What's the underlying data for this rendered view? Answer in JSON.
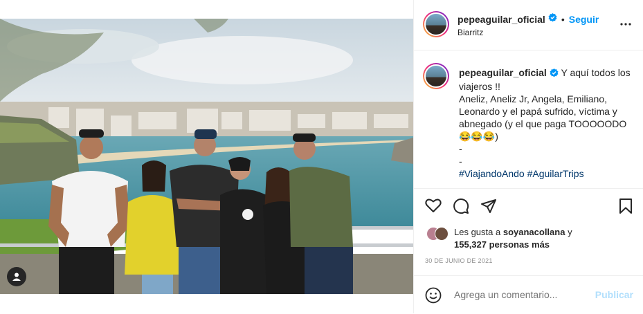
{
  "post": {
    "username": "pepeaguilar_oficial",
    "location": "Biarritz",
    "follow_label": "Seguir",
    "separator": "•"
  },
  "caption": {
    "username": "pepeaguilar_oficial",
    "lines": [
      "Y aquí todos los viajeros !!",
      "Aneliz, Aneliz Jr, Angela, Emiliano, Leonardo y el papá sufrido, víctima y abnegado (y el que paga TOOOOODO 😂😂😂)",
      "-",
      "-"
    ],
    "hashtags": [
      "#ViajandoAndo",
      "#AguilarTrips"
    ]
  },
  "likes": {
    "prefix": "Les gusta a",
    "user": "soyanacollana",
    "connector": "y",
    "count": "155,327 personas más"
  },
  "date": "30 DE JUNIO DE 2021",
  "comment": {
    "placeholder": "Agrega un comentario...",
    "publish_label": "Publicar"
  },
  "icons": {
    "verified": "verified-badge-icon",
    "more": "more-options-icon",
    "like": "heart-icon",
    "comment": "comment-icon",
    "share": "share-icon",
    "save": "bookmark-icon",
    "emoji": "emoji-icon",
    "tag": "user-tag-icon"
  },
  "colors": {
    "accent": "#0095f6",
    "publish_disabled": "#b2dffc",
    "hashtag": "#00376b",
    "secondary_text": "#8e8e8e"
  }
}
